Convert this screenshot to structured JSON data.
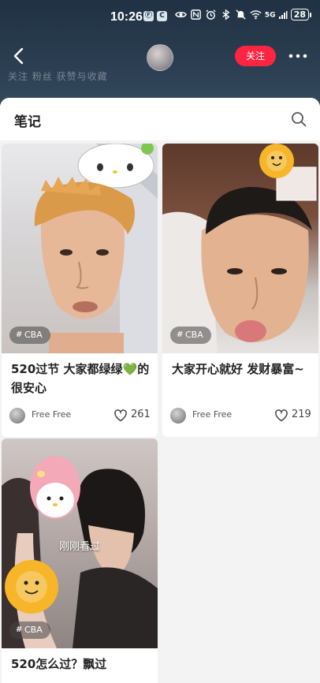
{
  "status_bar": {
    "time": "10:26",
    "small_badges": [
      "Ⓕ",
      "C"
    ],
    "icons": [
      "eye-icon",
      "nfc-icon",
      "alarm-icon",
      "bluetooth-icon",
      "mute-icon",
      "wifi-icon",
      "signal-5g-icon",
      "battery-icon"
    ],
    "network": "5G",
    "battery": "28"
  },
  "header": {
    "follow_label": "关注",
    "faded_tabs_text": "关注    粉丝    获赞与收藏"
  },
  "notes_section": {
    "title": "笔记"
  },
  "cards": [
    {
      "tag": "CBA",
      "title": "520过节 大家都绿绿💚的很安心",
      "author": "Free Free",
      "likes": "261"
    },
    {
      "tag": "CBA",
      "title": "大家开心就好 发财暴富~",
      "author": "Free Free",
      "likes": "219"
    },
    {
      "tag": "CBA",
      "overlay": "刚刚看过",
      "title": "520怎么过？飘过"
    }
  ],
  "colors": {
    "accent": "#ff2442",
    "header_bg": "#2c3f52",
    "page_bg": "#f3f3f3"
  }
}
